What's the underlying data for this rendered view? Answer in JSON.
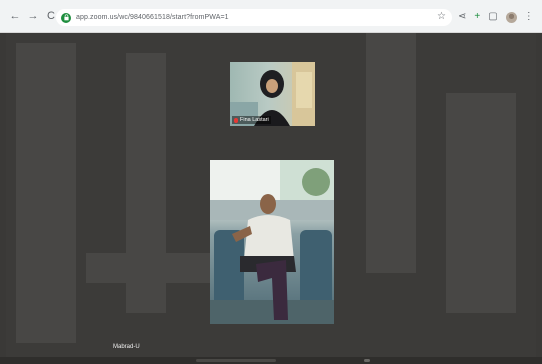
{
  "browser": {
    "url": "app.zoom.us/wc/9840661518/start?fromPWA=1",
    "back_glyph": "←",
    "forward_glyph": "→",
    "reload_glyph": "C",
    "star_glyph": "☆",
    "icons": [
      "back-icon",
      "forward-icon",
      "reload-icon",
      "star-icon",
      "share-icon",
      "extension-icon",
      "tab-icon",
      "profile-avatar",
      "menu-icon"
    ],
    "share_glyph": "⋖",
    "extension_glyph": "+",
    "tab_glyph": "▢",
    "menu_glyph": "⋮"
  },
  "meeting": {
    "participants": [
      {
        "name": "Fina Lastari",
        "muted": true
      },
      {
        "name": "Mabrad-U",
        "muted": false
      }
    ],
    "speaker_label": "Mabrad-U"
  },
  "colors": {
    "stage_bg": "#3c3b39",
    "muted_red": "#e53935",
    "secure_green": "#1e8e3e"
  }
}
